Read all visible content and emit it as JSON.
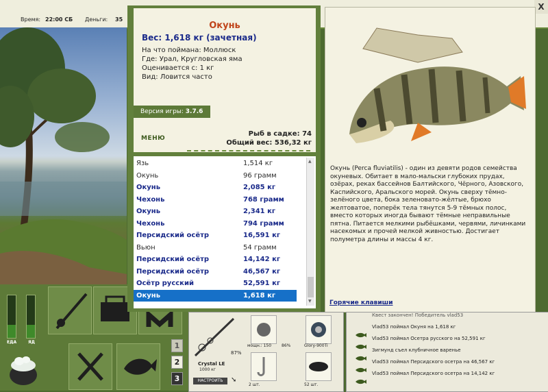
{
  "topbar": {
    "time_label": "Время:",
    "time_value": "22:00 СБ",
    "money_label": "Деньги:",
    "money_value": "35"
  },
  "close": "X",
  "fish_info": {
    "name": "Окунь",
    "weight": "Вес: 1,618 кг (зачетная)",
    "bait": "На что поймана: Моллюск",
    "place": "Где: Урал, Кругловская яма",
    "rated": "Оценивается с: 1 кг",
    "kind": "Вид: Ловится часто"
  },
  "version": {
    "label": "Версия игры: ",
    "value": "3.7.6"
  },
  "menu_label": "МЕНЮ",
  "keep": {
    "count": "Рыб в садке: 74",
    "total": "Общий вес: 536,32 кг"
  },
  "catch_list": [
    {
      "name": "Язь",
      "weight": "1,514 кг",
      "bold": false
    },
    {
      "name": "Окунь",
      "weight": "96 грамм",
      "bold": false
    },
    {
      "name": "Окунь",
      "weight": "2,085 кг",
      "bold": true
    },
    {
      "name": "Чехонь",
      "weight": "768 грамм",
      "bold": true
    },
    {
      "name": "Окунь",
      "weight": "2,341 кг",
      "bold": true
    },
    {
      "name": "Чехонь",
      "weight": "794 грамм",
      "bold": true
    },
    {
      "name": "Персидский осётр",
      "weight": "16,591 кг",
      "bold": true
    },
    {
      "name": "Вьюн",
      "weight": "54 грамм",
      "bold": false
    },
    {
      "name": "Персидский осётр",
      "weight": "14,142 кг",
      "bold": true
    },
    {
      "name": "Персидский осётр",
      "weight": "46,567 кг",
      "bold": true
    },
    {
      "name": "Осётр русский",
      "weight": "52,591 кг",
      "bold": true
    },
    {
      "name": "Окунь",
      "weight": "1,618 кг",
      "bold": true,
      "selected": true
    }
  ],
  "description": "Окунь (Perca fluviatilis) - один из девяти родов семейства окуневых. Обитает в мало-мальски глубоких прудах, озёрах, реках бассейнов Балтийского, Чёрного, Азовского, Каспийского, Аральского морей. Окунь сверху тёмно-зелёного цвета, бока зеленовато-жёлтые, брюхо желтоватое, поперёк тела тянутся 5-9 тёмных полос, вместо которых иногда бывают тёмные неправильные пятна. Питается мелкими рыбёшками, червями, личинками насекомых и прочей мелкой живностью. Достигает полуметра длины и массы 4 кг.",
  "hotkeys": "Горячие клавиши",
  "gauges": {
    "food_label": "ЕДА",
    "poison_label": "ЯД",
    "food_level": 0.3,
    "poison_level": 0.3
  },
  "slots": [
    "1",
    "2",
    "3"
  ],
  "tackle": {
    "rod_name": "Crystal LE",
    "rod_weight": "1000 кг",
    "rod_pct": "87%",
    "reel_label": "мощн.: 150",
    "reel_pct": "86%",
    "line_name": "Glory-900Ti",
    "setup_button": "НАСТРОИТЬ",
    "hooks_count": "2 шт.",
    "bait_count": "52 шт."
  },
  "chat": [
    "Квест закончен! Победитель vlad53",
    "Vlad53 поймал Окуня на 1,618 кг",
    "Vlad53 поймал Осетра русского на 52,591 кг",
    "Зигмунд съел клубничное варенье",
    "Vlad53 поймал Персидского осетра на 46,567 кг",
    "Vlad53 поймал Персидского осетра на 14,142 кг"
  ],
  "colors": {
    "accent": "#c0441a",
    "title_blue": "#1a2a8a",
    "selected": "#1670c8",
    "frame": "#62803c"
  }
}
